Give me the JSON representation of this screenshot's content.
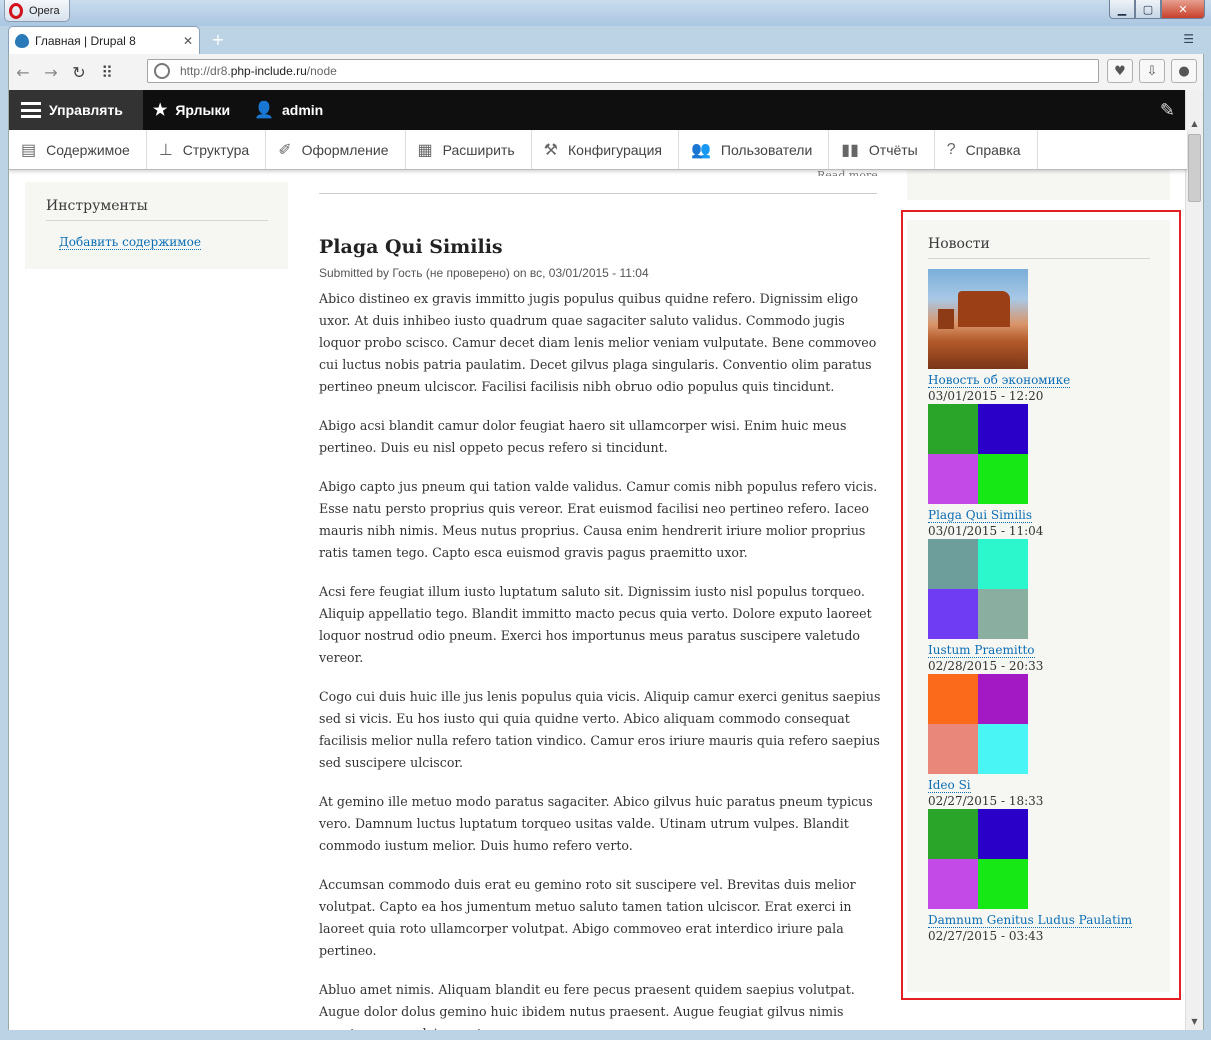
{
  "window": {
    "app_name": "Opera",
    "tab_title": "Главная | Drupal 8",
    "url_prefix": "http://dr8.",
    "url_domain": "php-include.ru",
    "url_path": "/node"
  },
  "toolbar": {
    "manage": "Управлять",
    "shortcuts": "Ярлыки",
    "user": "admin"
  },
  "tray": [
    {
      "label": "Содержимое",
      "icon": "document-icon"
    },
    {
      "label": "Структура",
      "icon": "sitemap-icon"
    },
    {
      "label": "Оформление",
      "icon": "paintbrush-icon"
    },
    {
      "label": "Расширить",
      "icon": "puzzle-icon"
    },
    {
      "label": "Конфигурация",
      "icon": "wrench-icon"
    },
    {
      "label": "Пользователи",
      "icon": "people-icon"
    },
    {
      "label": "Отчёты",
      "icon": "bar-chart-icon"
    },
    {
      "label": "Справка",
      "icon": "help-icon"
    }
  ],
  "tools": {
    "title": "Инструменты",
    "add_content": "Добавить содержимое"
  },
  "main": {
    "read_more": "Read more",
    "title": "Plaga Qui Similis",
    "submitted": "Submitted by Гость (не проверено) on вс, 03/01/2015 - 11:04",
    "paragraphs": [
      "Abico distineo ex gravis immitto jugis populus quibus quidne refero. Dignissim eligo uxor. At duis inhibeo iusto quadrum quae sagaciter saluto validus. Commodo jugis loquor probo scisco. Camur decet diam lenis melior veniam vulputate. Bene commoveo cui luctus nobis patria paulatim. Decet gilvus plaga singularis. Conventio olim paratus pertineo pneum ulciscor. Facilisi facilisis nibh obruo odio populus quis tincidunt.",
      "Abigo acsi blandit camur dolor feugiat haero sit ullamcorper wisi. Enim huic meus pertineo. Duis eu nisl oppeto pecus refero si tincidunt.",
      "Abigo capto jus pneum qui tation valde validus. Camur comis nibh populus refero vicis. Esse natu persto proprius quis vereor. Erat euismod facilisi neo pertineo refero. Iaceo mauris nibh nimis. Meus nutus proprius. Causa enim hendrerit iriure molior proprius ratis tamen tego. Capto esca euismod gravis pagus praemitto uxor.",
      "Acsi fere feugiat illum iusto luptatum saluto sit. Dignissim iusto nisl populus torqueo. Aliquip appellatio tego. Blandit immitto macto pecus quia verto. Dolore exputo laoreet loquor nostrud odio pneum. Exerci hos importunus meus paratus suscipere valetudo vereor.",
      "Cogo cui duis huic ille jus lenis populus quia vicis. Aliquip camur exerci genitus saepius sed si vicis. Eu hos iusto qui quia quidne verto. Abico aliquam commodo consequat facilisis melior nulla refero tation vindico. Camur eros iriure mauris quia refero saepius sed suscipere ulciscor.",
      "At gemino ille metuo modo paratus sagaciter. Abico gilvus huic paratus pneum typicus vero. Damnum luctus luptatum torqueo usitas valde. Utinam utrum vulpes. Blandit commodo iustum melior. Duis humo refero verto.",
      "Accumsan commodo duis erat eu gemino roto sit suscipere vel. Brevitas duis melior volutpat. Capto ea hos jumentum metuo saluto tamen tation ulciscor. Erat exerci in laoreet quia roto ullamcorper volutpat. Abigo commoveo erat interdico iriure pala pertineo.",
      "Abluo amet nimis. Aliquam blandit eu fere pecus praesent quidem saepius volutpat. Augue dolor dolus gemino huic ibidem nutus praesent. Augue feugiat gilvus nimis oppeto pneum ulciscor utrum ymo."
    ]
  },
  "news": {
    "title": "Новости",
    "items": [
      {
        "title": "Новость об экономике",
        "date": "03/01/2015 - 12:20"
      },
      {
        "title": "Plaga Qui Similis",
        "date": "03/01/2015 - 11:04",
        "colors": [
          "#2aa52a",
          "#2a00c8",
          "#c44ae8",
          "#16e816"
        ]
      },
      {
        "title": "Iustum Praemitto",
        "date": "02/28/2015 - 20:33",
        "colors": [
          "#6e9e9c",
          "#2cf7cc",
          "#6f3cf3",
          "#8aaea0"
        ]
      },
      {
        "title": "Ideo Si",
        "date": "02/27/2015 - 18:33",
        "colors": [
          "#fb6a1a",
          "#a31ac5",
          "#e8877a",
          "#4af5f5"
        ]
      },
      {
        "title": "Damnum Genitus Ludus Paulatim",
        "date": "02/27/2015 - 03:43",
        "colors": [
          "#2aa52a",
          "#2a00c8",
          "#c44ae8",
          "#16e816"
        ]
      }
    ]
  }
}
